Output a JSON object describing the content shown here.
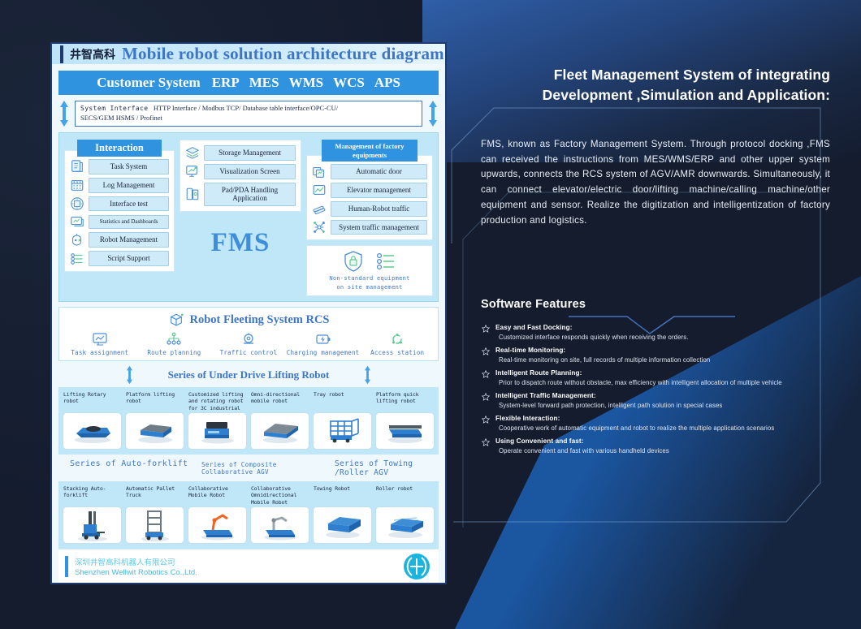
{
  "card": {
    "cn_logo": "井智高科",
    "title": "Mobile robot solution architecture diagram",
    "customer_system": {
      "label": "Customer System",
      "systems": [
        "ERP",
        "MES",
        "WMS",
        "WCS",
        "APS"
      ]
    },
    "system_interface": {
      "label": "System Interface",
      "line1": "HTTP Interface / Modbus TCP/ Database table interface/OPC-CU/",
      "line2": "SECS/GEM HSMS / Profinet"
    },
    "interaction": {
      "tab": "Interaction",
      "items": [
        {
          "label": "Task System",
          "icon": "document-list-icon"
        },
        {
          "label": "Log Management",
          "icon": "calendar-icon"
        },
        {
          "label": "Interface test",
          "icon": "chip-icon"
        },
        {
          "label": "Statistics and Dashboards",
          "icon": "monitor-icon"
        },
        {
          "label": "Robot Management",
          "icon": "robot-head-icon"
        },
        {
          "label": "Script Support",
          "icon": "sliders-icon"
        }
      ]
    },
    "middle": {
      "items": [
        {
          "label": "Storage Management",
          "icon": "layers-icon"
        },
        {
          "label": "Visualization Screen",
          "icon": "screen-chart-icon"
        },
        {
          "label": "Pad/PDA Handling Application",
          "icon": "tablet-icon"
        }
      ],
      "fms_word": "FMS"
    },
    "factory": {
      "tab": "Management of factory equipments",
      "items": [
        {
          "label": "Automatic door",
          "icon": "doors-icon"
        },
        {
          "label": "Elevator management",
          "icon": "elevator-icon"
        },
        {
          "label": "Human-Robot traffic",
          "icon": "crossing-icon"
        },
        {
          "label": "System traffic management",
          "icon": "network-icon"
        }
      ],
      "nonstandard": {
        "line1": "Non-standard equipment",
        "line2": "on site management",
        "icons": [
          "shield-lock-icon",
          "sliders-icon"
        ]
      }
    },
    "rcs": {
      "title": "Robot Fleeting System RCS",
      "title_icon": "cube-box-icon",
      "items": [
        {
          "label": "Task assignment",
          "icon": "monitor-chart-icon"
        },
        {
          "label": "Route planning",
          "icon": "route-tree-icon"
        },
        {
          "label": "Traffic control",
          "icon": "traffic-light-icon"
        },
        {
          "label": "Charging management",
          "icon": "battery-bolt-icon"
        },
        {
          "label": "Access station",
          "icon": "refresh-circle-icon"
        }
      ]
    },
    "series_banner": "Series of Under Drive Lifting Robot",
    "robots_row1": [
      {
        "name": "Lifting Rotary robot"
      },
      {
        "name": "Platform lifting robot"
      },
      {
        "name": "Customized lifting and rotating robot for 3C industrial"
      },
      {
        "name": "Omni-directional mobile robot"
      },
      {
        "name": "Tray robot"
      },
      {
        "name": "Platform quick lifting robot"
      }
    ],
    "categories": [
      "Series of Auto-forklift",
      "Series of Composite Collaborative AGV",
      "Series of Towing /Roller AGV"
    ],
    "robots_row2": [
      {
        "name": "Stacking Auto-forklift"
      },
      {
        "name": "Automatic Pallet Truck"
      },
      {
        "name": "Collaborative Mobile Robot"
      },
      {
        "name": "Collaborative Omnidirectional Mobile Robot"
      },
      {
        "name": "Towing Robot"
      },
      {
        "name": "Roller robot"
      }
    ],
    "footer": {
      "cn": "深圳井智高科机器人有限公司",
      "en": "Shenzhen Wellwit Robotics Co.,Ltd.",
      "logo_icon": "wellwit-logo-icon"
    }
  },
  "right": {
    "title": "Fleet Management System of  integrating Development ,Simulation and Application:",
    "body": "FMS, known as Factory Management System. Through protocol docking ,FMS can received the instructions from MES/WMS/ERP and other upper system upwards, connects the RCS system of AGV/AMR downwards. Simultaneously, it can connect elevator/electric door/lifting machine/calling machine/other equipment and sensor. Realize the digitization and intelligentization of factory production and logistics.",
    "features_title": "Software Features",
    "features": [
      {
        "heading": "Easy and Fast Docking:",
        "detail": "Customized interface responds quickly when receiving the orders."
      },
      {
        "heading": "Real-time Monitoring:",
        "detail": "Real-time monitoring on site, full records of multiple information collection"
      },
      {
        "heading": "Intelligent Route Planning:",
        "detail": "Prior to dispatch route without obstacle, max efficiency with intelligent allocation of multiple vehicle"
      },
      {
        "heading": "Intelligent Traffic Management:",
        "detail": "System-level forward path protection, intelligent path solution in special cases"
      },
      {
        "heading": "Flexible Interaction:",
        "detail": "Cooperative work of automatic equipment and robot to realize the multiple application scenarios"
      },
      {
        "heading": "Using Convenient and fast:",
        "detail": "Operate convenient and fast with various handheld devices"
      }
    ]
  },
  "colors": {
    "background": "#141c2e",
    "accent_blue": "#2f93e0",
    "title_blue": "#3d76c9",
    "panel_light": "#bfe7f8",
    "diag_blue": "#1c5bab"
  }
}
